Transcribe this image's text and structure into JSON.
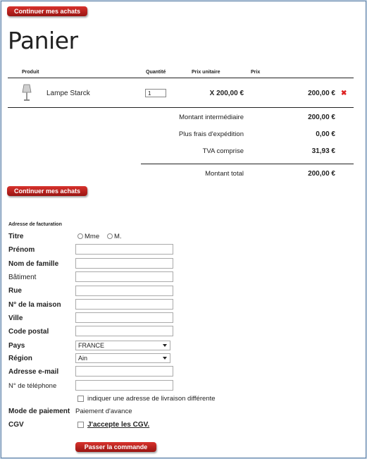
{
  "buttons": {
    "continue_top": "Continuer mes achats",
    "continue_bottom": "Continuer mes achats",
    "submit": "Passer la commande"
  },
  "page_title": "Panier",
  "cart": {
    "columns": {
      "product": "Produit",
      "quantity": "Quantité",
      "unit_price": "Prix unitaire",
      "price": "Prix"
    },
    "item": {
      "name": "Lampe Starck",
      "quantity": "1",
      "unit_price": "X 200,00 €",
      "price": "200,00 €",
      "remove_icon": "close-icon"
    },
    "summary": {
      "subtotal_label": "Montant intermédiaire",
      "subtotal_value": "200,00 €",
      "shipping_label": "Plus frais d'expédition",
      "shipping_value": "0,00 €",
      "tax_label": "TVA comprise",
      "tax_value": "31,93 €",
      "total_label": "Montant total",
      "total_value": "200,00 €"
    }
  },
  "billing": {
    "section_title": "Adresse de facturation",
    "title_label": "Titre",
    "title_options": [
      "Mme",
      "M."
    ],
    "first_name": "Prénom",
    "last_name": "Nom de famille",
    "building": "Bâtiment",
    "street": "Rue",
    "house_number": "N° de la maison",
    "city": "Ville",
    "postal_code": "Code postal",
    "country_label": "Pays",
    "country_value": "FRANCE",
    "region_label": "Région",
    "region_value": "Ain",
    "email": "Adresse e-mail",
    "phone": "N° de téléphone",
    "different_delivery": "indiquer une adresse de livraison différente",
    "payment_label": "Mode de paiement",
    "payment_value": "Paiement d'avance",
    "terms_label": "CGV",
    "terms_accept": "J'accepte les CGV."
  }
}
